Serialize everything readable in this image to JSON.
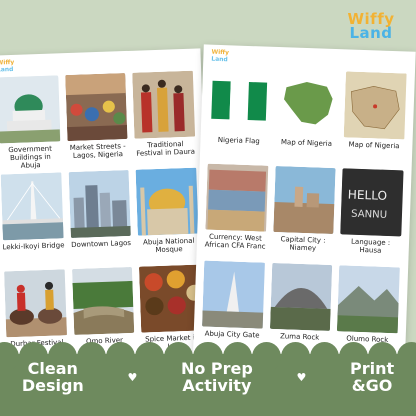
{
  "brand": {
    "line1": "Wiffy",
    "line2": "Land"
  },
  "left_sheet": {
    "cards": [
      {
        "caption": "Government Buildings in Abuja",
        "icon": "mosque-dome"
      },
      {
        "caption": "Market Streets - Lagos, Nigeria",
        "icon": "market-crowd"
      },
      {
        "caption": "Traditional Festival in Daura",
        "icon": "festival"
      },
      {
        "caption": "Lekki-Ikoyi Bridge",
        "icon": "bridge"
      },
      {
        "caption": "Downtown Lagos",
        "icon": "city"
      },
      {
        "caption": "Abuja National Mosque",
        "icon": "gold-dome"
      },
      {
        "caption": "Durbar Festival",
        "icon": "horse-riders"
      },
      {
        "caption": "Omo River",
        "icon": "river"
      },
      {
        "caption": "Spice Market in Jos",
        "icon": "spices"
      }
    ]
  },
  "right_sheet": {
    "cards": [
      {
        "caption": "Nigeria Flag",
        "icon": "flag"
      },
      {
        "caption": "Map of Nigeria",
        "icon": "map-green"
      },
      {
        "caption": "Map of Nigeria",
        "icon": "map-atlas"
      },
      {
        "caption": "Currency: West African CFA Franc",
        "icon": "banknotes"
      },
      {
        "caption": "Capital City : Niamey",
        "icon": "city-dusk"
      },
      {
        "caption": "Language : Hausa",
        "icon": "chalkboard"
      },
      {
        "caption": "Abuja City Gate",
        "icon": "gate"
      },
      {
        "caption": "Zuma Rock",
        "icon": "rock"
      },
      {
        "caption": "Olumo Rock",
        "icon": "hills"
      }
    ]
  },
  "chalkboard": {
    "line1": "HELLO",
    "line2": "SANNU"
  },
  "banner": {
    "tag1_a": "Clean",
    "tag1_b": "Design",
    "tag2_a": "No Prep",
    "tag2_b": "Activity",
    "tag3_a": "Print",
    "tag3_b": "&GO",
    "separator": "♥"
  },
  "colors": {
    "flag_green": "#118a4a",
    "banner": "#6e8a5e",
    "background": "#cbd8c1"
  }
}
